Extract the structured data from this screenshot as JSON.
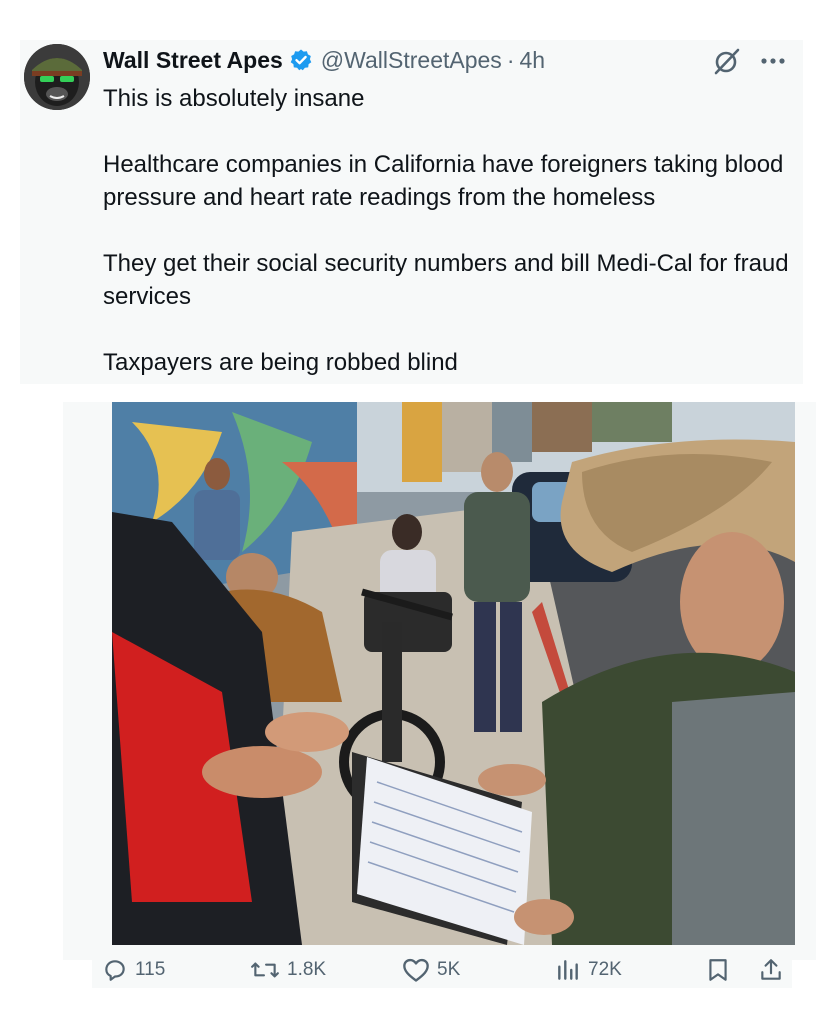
{
  "author": {
    "name": "Wall Street Apes",
    "handle": "@WallStreetApes",
    "separator": "·",
    "time": "4h",
    "verified": true,
    "avatar_icon": "gorilla-avatar-icon"
  },
  "tweet": {
    "paragraphs": [
      "This is absolutely insane",
      "Healthcare companies in California have foreigners taking blood pressure and heart rate readings from the homeless",
      "They get their social security numbers and bill Medi-Cal for fraud services",
      "Taxpayers are being robbed blind"
    ]
  },
  "media": {
    "type": "photo",
    "icon": "street-photo-icon"
  },
  "actions": {
    "replies": "115",
    "reposts": "1.8K",
    "likes": "5K",
    "views": "72K"
  },
  "colors": {
    "verified_blue": "#1d9bf0",
    "muted_text": "#536471",
    "primary_text": "#0f1419",
    "card_bg": "#f7f9f9"
  }
}
